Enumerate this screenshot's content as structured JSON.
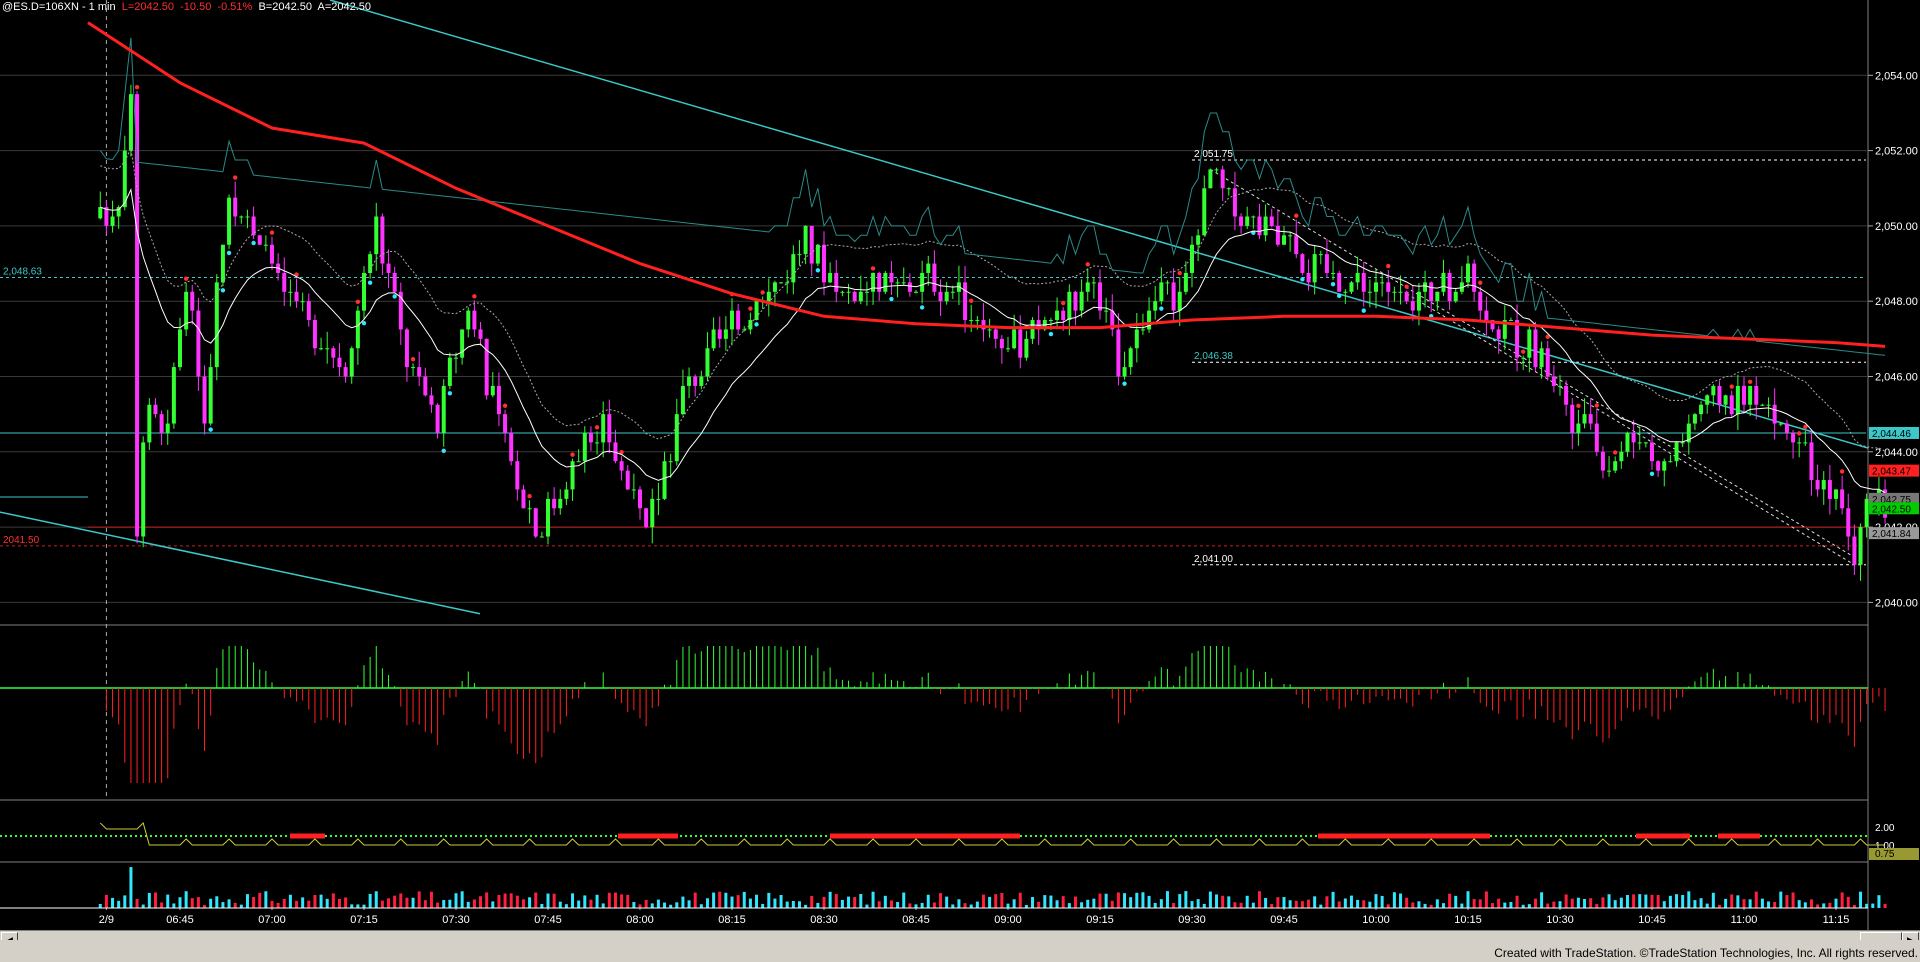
{
  "header": {
    "symbol": "@ES.D=106XN - 1 min",
    "last": "L=2042.50",
    "change": "-10.50",
    "change_pct": "-0.51%",
    "bid": "B=2042.50",
    "ask": "A=2042.50"
  },
  "footer": {
    "credit": "Created with TradeStation. ©TradeStation Technologies, Inc. All rights reserved."
  },
  "colors": {
    "background": "#000000",
    "bull_candle": "#33ff33",
    "bear_candle": "#ff33ff",
    "ma_slow": "#ff2020",
    "ma_fast": "#ffffff",
    "trendline": "#3cc8c8",
    "volume_up": "#33e6ff",
    "volume_down": "#ff2040"
  },
  "chart_data": {
    "type": "candlestick",
    "title": "@ES.D=106XN - 1 min",
    "x_tick_labels": [
      "2/9",
      "06:45",
      "07:00",
      "07:15",
      "07:30",
      "07:45",
      "08:00",
      "08:15",
      "08:30",
      "08:45",
      "09:00",
      "09:15",
      "09:30",
      "09:45",
      "10:00",
      "10:15",
      "10:30",
      "10:45",
      "11:00",
      "11:15"
    ],
    "y_tick_labels": [
      "2,054.00",
      "2,052.00",
      "2,050.00",
      "2,048.00",
      "2,046.00",
      "2,044.00",
      "2,042.00",
      "2,040.00"
    ],
    "ylim": [
      2039.4,
      2056.0
    ],
    "price_path": [
      {
        "t": "06:32",
        "p": 2050.2
      },
      {
        "t": "06:35",
        "p": 2050.8
      },
      {
        "t": "06:37",
        "p": 2053.8
      },
      {
        "t": "06:38",
        "p": 2042.0
      },
      {
        "t": "06:40",
        "p": 2045.5
      },
      {
        "t": "06:43",
        "p": 2044.5
      },
      {
        "t": "06:46",
        "p": 2048.5
      },
      {
        "t": "06:49",
        "p": 2045.2
      },
      {
        "t": "06:53",
        "p": 2051.0
      },
      {
        "t": "06:58",
        "p": 2049.3
      },
      {
        "t": "07:03",
        "p": 2048.0
      },
      {
        "t": "07:08",
        "p": 2047.0
      },
      {
        "t": "07:12",
        "p": 2046.4
      },
      {
        "t": "07:17",
        "p": 2050.0
      },
      {
        "t": "07:22",
        "p": 2046.5
      },
      {
        "t": "07:27",
        "p": 2044.8
      },
      {
        "t": "07:32",
        "p": 2048.0
      },
      {
        "t": "07:37",
        "p": 2044.6
      },
      {
        "t": "07:43",
        "p": 2042.0
      },
      {
        "t": "07:48",
        "p": 2043.3
      },
      {
        "t": "07:54",
        "p": 2044.7
      },
      {
        "t": "08:01",
        "p": 2041.8
      },
      {
        "t": "08:07",
        "p": 2045.5
      },
      {
        "t": "08:13",
        "p": 2047.0
      },
      {
        "t": "08:20",
        "p": 2048.0
      },
      {
        "t": "08:27",
        "p": 2049.5
      },
      {
        "t": "08:33",
        "p": 2048.3
      },
      {
        "t": "08:40",
        "p": 2048.3
      },
      {
        "t": "08:47",
        "p": 2048.6
      },
      {
        "t": "08:53",
        "p": 2048.0
      },
      {
        "t": "09:00",
        "p": 2046.8
      },
      {
        "t": "09:07",
        "p": 2047.5
      },
      {
        "t": "09:13",
        "p": 2048.7
      },
      {
        "t": "09:18",
        "p": 2046.4
      },
      {
        "t": "09:24",
        "p": 2048.0
      },
      {
        "t": "09:28",
        "p": 2048.0
      },
      {
        "t": "09:33",
        "p": 2051.5
      },
      {
        "t": "09:37",
        "p": 2050.4
      },
      {
        "t": "09:43",
        "p": 2049.8
      },
      {
        "t": "09:50",
        "p": 2048.8
      },
      {
        "t": "09:58",
        "p": 2048.5
      },
      {
        "t": "10:05",
        "p": 2047.9
      },
      {
        "t": "10:10",
        "p": 2048.4
      },
      {
        "t": "10:15",
        "p": 2048.6
      },
      {
        "t": "10:20",
        "p": 2047.4
      },
      {
        "t": "10:27",
        "p": 2046.5
      },
      {
        "t": "10:31",
        "p": 2045.0
      },
      {
        "t": "10:38",
        "p": 2043.8
      },
      {
        "t": "10:43",
        "p": 2044.5
      },
      {
        "t": "10:47",
        "p": 2043.6
      },
      {
        "t": "10:53",
        "p": 2045.3
      },
      {
        "t": "11:00",
        "p": 2045.5
      },
      {
        "t": "11:05",
        "p": 2045.0
      },
      {
        "t": "11:10",
        "p": 2043.8
      },
      {
        "t": "11:15",
        "p": 2043.0
      },
      {
        "t": "11:18",
        "p": 2041.0
      },
      {
        "t": "11:21",
        "p": 2043.2
      },
      {
        "t": "11:23",
        "p": 2042.5
      }
    ],
    "moving_average_slow": [
      {
        "t": "06:30",
        "p": 2055.4
      },
      {
        "t": "06:45",
        "p": 2053.8
      },
      {
        "t": "07:00",
        "p": 2052.6
      },
      {
        "t": "07:15",
        "p": 2052.2
      },
      {
        "t": "07:30",
        "p": 2051.0
      },
      {
        "t": "07:45",
        "p": 2050.0
      },
      {
        "t": "08:00",
        "p": 2049.0
      },
      {
        "t": "08:15",
        "p": 2048.2
      },
      {
        "t": "08:30",
        "p": 2047.6
      },
      {
        "t": "08:45",
        "p": 2047.4
      },
      {
        "t": "09:00",
        "p": 2047.3
      },
      {
        "t": "09:15",
        "p": 2047.3
      },
      {
        "t": "09:30",
        "p": 2047.5
      },
      {
        "t": "09:45",
        "p": 2047.6
      },
      {
        "t": "10:00",
        "p": 2047.6
      },
      {
        "t": "10:15",
        "p": 2047.5
      },
      {
        "t": "10:30",
        "p": 2047.3
      },
      {
        "t": "10:45",
        "p": 2047.1
      },
      {
        "t": "11:00",
        "p": 2047.0
      },
      {
        "t": "11:15",
        "p": 2046.9
      },
      {
        "t": "11:23",
        "p": 2046.8
      }
    ],
    "horizontal_levels": [
      {
        "price": 2051.75,
        "label": "2,051.75",
        "style": "dashed"
      },
      {
        "price": 2048.63,
        "label": "2,048.63",
        "style": "dashed"
      },
      {
        "price": 2046.38,
        "label": "2,046.38",
        "style": "dashed"
      },
      {
        "price": 2044.5,
        "label": "",
        "style": "solid"
      },
      {
        "price": 2041.5,
        "label": "2041.50",
        "style": "dashed"
      },
      {
        "price": 2041.0,
        "label": "2,041.00",
        "style": "dashed"
      }
    ],
    "right_axis_markers": [
      {
        "price": 2044.5,
        "label": "2,044.46",
        "color": "#3cc8c8"
      },
      {
        "price": 2043.5,
        "label": "2,043.47",
        "color": "#ff2020"
      },
      {
        "price": 2042.75,
        "label": "2,042.75",
        "color": "#777777"
      },
      {
        "price": 2042.5,
        "label": "2,042.50",
        "color": "#00cc00"
      },
      {
        "price": 2041.84,
        "label": "2,041.84",
        "color": "#999999"
      }
    ],
    "lower_panel_labels": [
      "2.00",
      "1.00",
      "0.75"
    ]
  }
}
